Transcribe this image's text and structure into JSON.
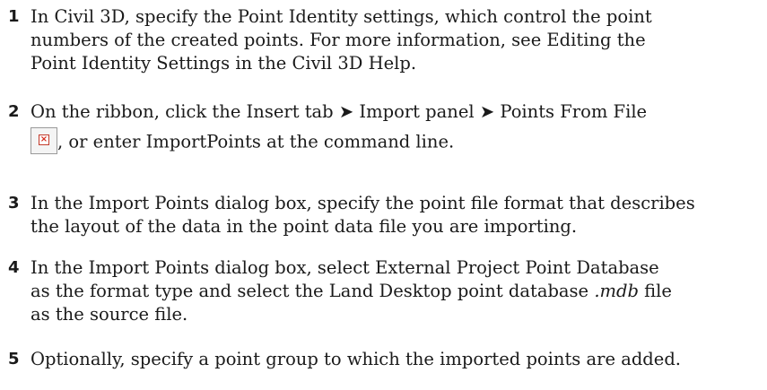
{
  "steps": [
    {
      "number": "1",
      "lines": [
        "In Civil 3D, specify the Point Identity settings, which control the point",
        "numbers of the created points. For more information, see Editing the",
        "Point Identity Settings in the Civil 3D Help."
      ]
    },
    {
      "number": "2",
      "line1": "On the ribbon, click the Insert tab ➤ Import panel ➤ Points From File",
      "line2": ", or enter ImportPoints at the command line.",
      "icon": "broken-image-icon"
    },
    {
      "number": "3",
      "lines": [
        "In the Import Points dialog box, specify the point file format that describes",
        "the layout of the data in the point data file you are importing."
      ]
    },
    {
      "number": "4",
      "line1": "In the Import Points dialog box, select External Project Point Database",
      "line2": "as the format type and select the Land Desktop point database",
      "line3_prefix": " ",
      "line3_italic": ".mdb",
      "line3_suffix": " file",
      "line4": "as the source file."
    },
    {
      "number": "5",
      "lines": [
        "Optionally, specify a point group to which the imported points are added."
      ]
    }
  ]
}
